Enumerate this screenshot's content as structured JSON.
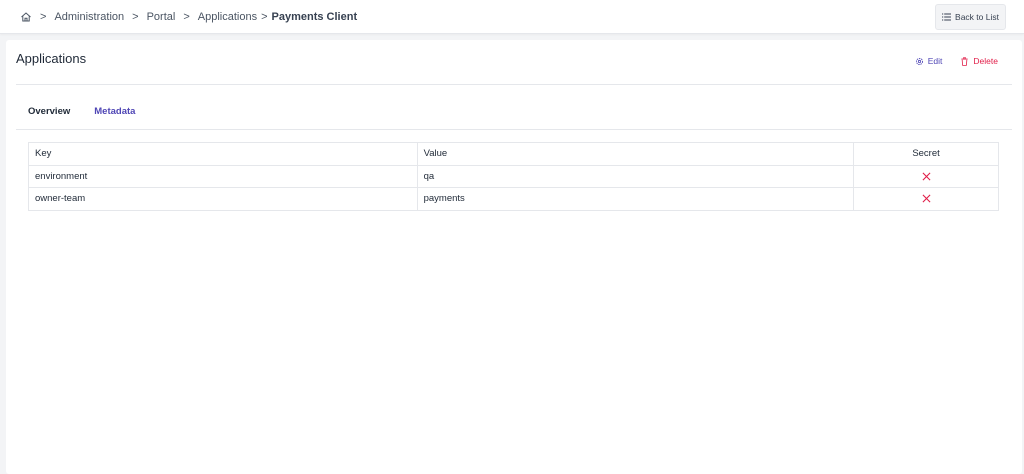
{
  "breadcrumb": {
    "items": [
      "Administration",
      "Portal",
      "Applications"
    ],
    "current": "Payments Client"
  },
  "header": {
    "back_label": "Back to List"
  },
  "page": {
    "title": "Applications",
    "edit_label": "Edit",
    "delete_label": "Delete"
  },
  "tabs": [
    {
      "label": "Overview",
      "active": false
    },
    {
      "label": "Metadata",
      "active": true
    }
  ],
  "table": {
    "columns": [
      "Key",
      "Value",
      "Secret"
    ],
    "rows": [
      {
        "key": "environment",
        "value": "qa",
        "secret": "x-icon"
      },
      {
        "key": "owner-team",
        "value": "payments",
        "secret": "x-icon"
      }
    ]
  },
  "colors": {
    "accent": "#4f46b5",
    "danger": "#e11d48"
  }
}
